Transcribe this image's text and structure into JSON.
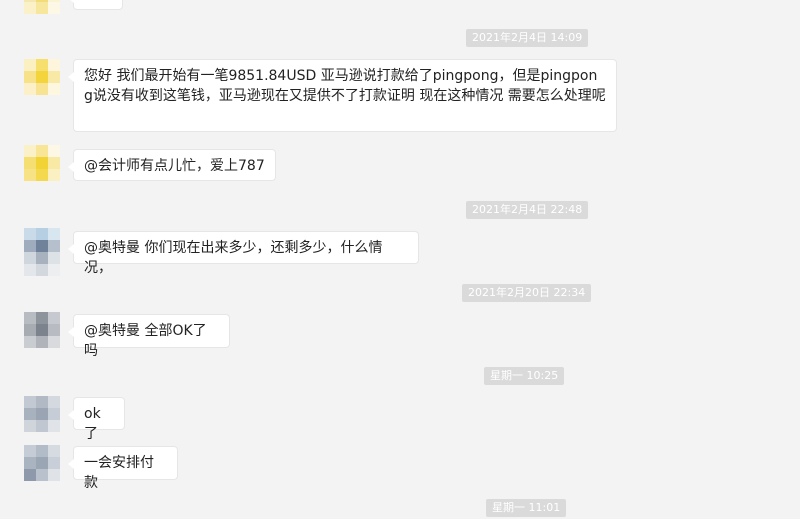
{
  "timestamps": [
    "2021年2月4日 14:09",
    "2021年2月4日 22:48",
    "2021年2月20日 22:34",
    "星期一 10:25",
    "星期一 11:01"
  ],
  "messages": [
    {
      "text": "您好 我们最开始有一笔9851.84USD 亚马逊说打款给了pingpong，但是pingpong说没有收到这笔钱，亚马逊现在又提供不了打款证明 现在这种情况 需要怎么处理呢"
    },
    {
      "text": "@会计师有点儿忙，爱上787"
    },
    {
      "text": "@奥特曼 你们现在出来多少，还剩多少，什么情况，"
    },
    {
      "text": "@奥特曼 全部OK了吗"
    },
    {
      "text": "ok了"
    },
    {
      "text": "一会安排付款"
    }
  ],
  "colors": {
    "background": "#f3f3f3",
    "bubble": "#ffffff",
    "timestamp_bg": "#dadada"
  }
}
